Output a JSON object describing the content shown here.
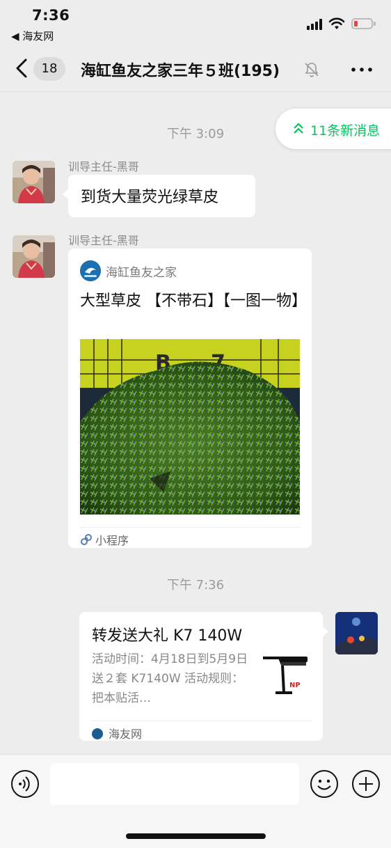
{
  "status_bar": {
    "time": "7:36",
    "back_app": "◀ 海友网",
    "battery_color": "#ff3b30"
  },
  "nav": {
    "unread_count": "18",
    "title": "海缸鱼友之家三年５班(195)",
    "icons": [
      "back-chevron-icon",
      "mute-bell-icon",
      "more-dots-icon"
    ]
  },
  "new_messages": {
    "label": "11条新消息",
    "color": "#07c160"
  },
  "messages": [
    {
      "type": "timestamp",
      "text": "下午 3:09"
    },
    {
      "type": "text",
      "sender": "训导主任-黑哥",
      "text": "到货大量荧光绿草皮"
    },
    {
      "type": "mini_program",
      "sender": "训导主任-黑哥",
      "source": "海缸鱼友之家",
      "title": "大型草皮 【不带石】【一图一物】",
      "footer": "小程序"
    },
    {
      "type": "timestamp",
      "text": "下午 7:36"
    },
    {
      "type": "link_card",
      "title": "转发送大礼 K7 140W",
      "description": "活动时间：4月18日到5月9日送２套 K7140W 活动规则：把本贴活…",
      "footer": "海友网"
    }
  ],
  "input_bar": {
    "icons": [
      "voice-icon",
      "emoji-icon",
      "plus-icon"
    ],
    "text_value": ""
  }
}
